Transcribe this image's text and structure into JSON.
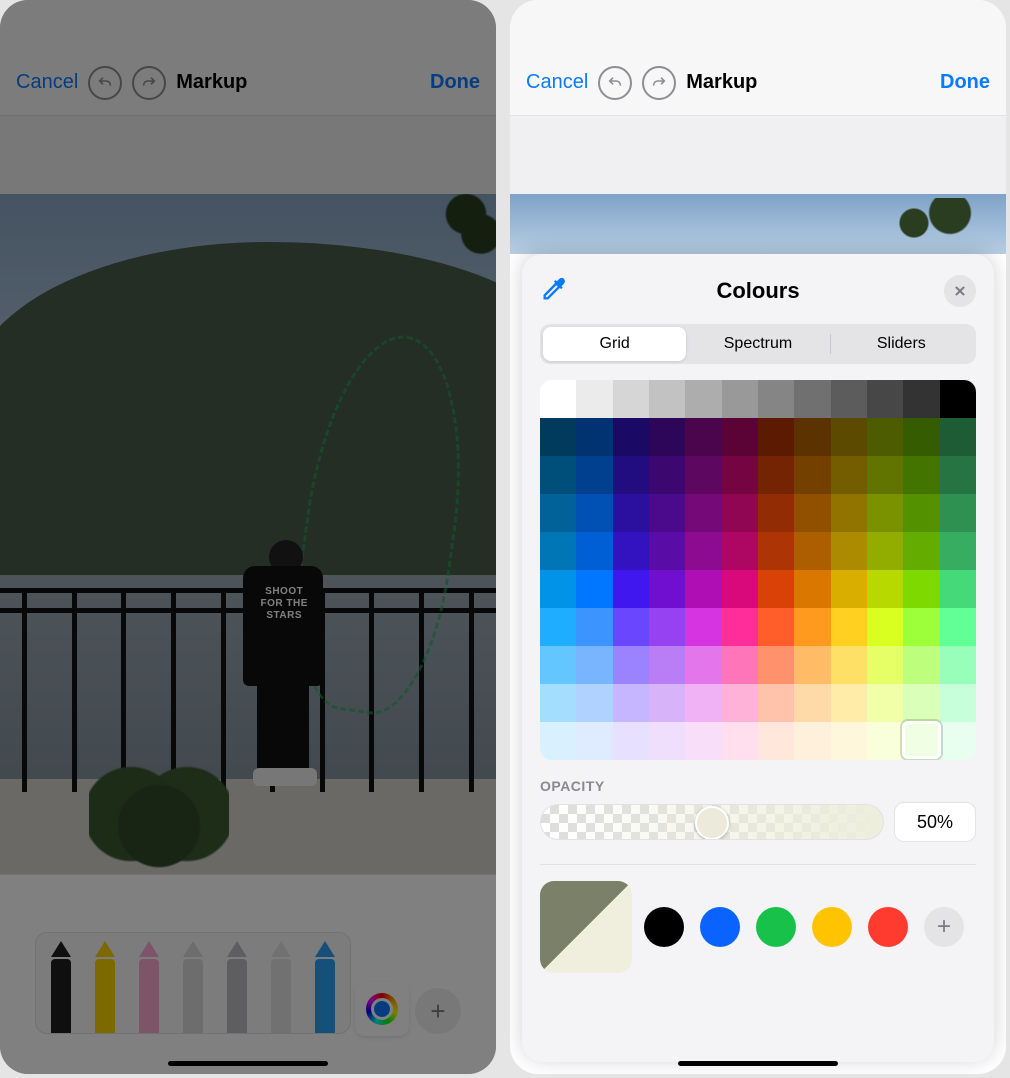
{
  "nav": {
    "cancel": "Cancel",
    "title": "Markup",
    "done": "Done"
  },
  "tshirt": {
    "line1": "SHOOT",
    "line2": "FOR THE",
    "line3": "STARS"
  },
  "tools": {
    "items": [
      {
        "name": "pen",
        "color": "#1d1d1f"
      },
      {
        "name": "marker",
        "color": "#fcd200"
      },
      {
        "name": "highlighter",
        "color": "#fca7d2"
      },
      {
        "name": "eraser",
        "color": "#d9d9db"
      },
      {
        "name": "lasso",
        "color": "#bdbdc0"
      },
      {
        "name": "ruler",
        "color": "#e2e2e4"
      },
      {
        "name": "pencil",
        "color": "#2aa0f5"
      }
    ]
  },
  "colours": {
    "title": "Colours",
    "tabs": [
      "Grid",
      "Spectrum",
      "Sliders"
    ],
    "active_tab": 0,
    "opacity_label": "OPACITY",
    "opacity_value": "50%",
    "opacity_pct": 50,
    "preset_swatches": [
      "#000000",
      "#0a63ff",
      "#18c24a",
      "#ffc300",
      "#ff3b30"
    ],
    "current": {
      "base": "#7b8068",
      "tinted": "#f0eedc"
    },
    "grid_selected": {
      "row": 9,
      "col": 10
    },
    "grid_rows": [
      [
        "#ffffff",
        "#ebebeb",
        "#d6d6d6",
        "#c2c2c2",
        "#adadad",
        "#999999",
        "#858585",
        "#707070",
        "#5c5c5c",
        "#474747",
        "#333333",
        "#000000"
      ],
      [
        "#003a5c",
        "#013373",
        "#1a0a66",
        "#2e0659",
        "#4a054d",
        "#5c0335",
        "#5c1a03",
        "#5c3200",
        "#5c4a00",
        "#4e5c00",
        "#355c00",
        "#1d5c34"
      ],
      [
        "#004e7a",
        "#01408f",
        "#220d80",
        "#3c086f",
        "#5e0760",
        "#740542",
        "#742303",
        "#744000",
        "#745d00",
        "#617400",
        "#437400",
        "#257441"
      ],
      [
        "#006299",
        "#0150b3",
        "#2b109f",
        "#4b0a8b",
        "#750978",
        "#910652",
        "#912c04",
        "#914f00",
        "#917400",
        "#7a9100",
        "#549100",
        "#2e9151"
      ],
      [
        "#0076b7",
        "#015fd6",
        "#3313bf",
        "#5a0ca6",
        "#8c0b90",
        "#ad0763",
        "#ad3505",
        "#ad5f00",
        "#ad8b00",
        "#92ad00",
        "#64ad00",
        "#37ad61"
      ],
      [
        "#0093e8",
        "#0177ff",
        "#4018ef",
        "#710fd0",
        "#af0eb4",
        "#d9097c",
        "#d94206",
        "#d97700",
        "#d9ae00",
        "#b7d900",
        "#7ed900",
        "#45d97a"
      ],
      [
        "#1faeff",
        "#3b94ff",
        "#6a47ff",
        "#9642f1",
        "#d534e0",
        "#ff2d9a",
        "#ff5d29",
        "#ff9a1f",
        "#ffd01f",
        "#d8ff1f",
        "#9dff3a",
        "#62ff97"
      ],
      [
        "#63c6ff",
        "#78b4ff",
        "#9b82ff",
        "#b97df6",
        "#e476ec",
        "#ff75ba",
        "#ff926c",
        "#ffbb66",
        "#ffe066",
        "#e7ff66",
        "#bdff7d",
        "#97ffba"
      ],
      [
        "#a3ddff",
        "#afd2ff",
        "#c6b6ff",
        "#d7b4fa",
        "#f0b2f4",
        "#ffb2d8",
        "#ffc3ab",
        "#ffdaa9",
        "#ffeca9",
        "#f2ffa9",
        "#daffb8",
        "#c6ffd9"
      ],
      [
        "#d9f0ff",
        "#dfecff",
        "#e8e0ff",
        "#efdffd",
        "#f9defa",
        "#ffdeee",
        "#ffe7dc",
        "#fff0db",
        "#fff7db",
        "#f9ffdb",
        "#f0ffe3",
        "#e8fff0"
      ]
    ]
  }
}
